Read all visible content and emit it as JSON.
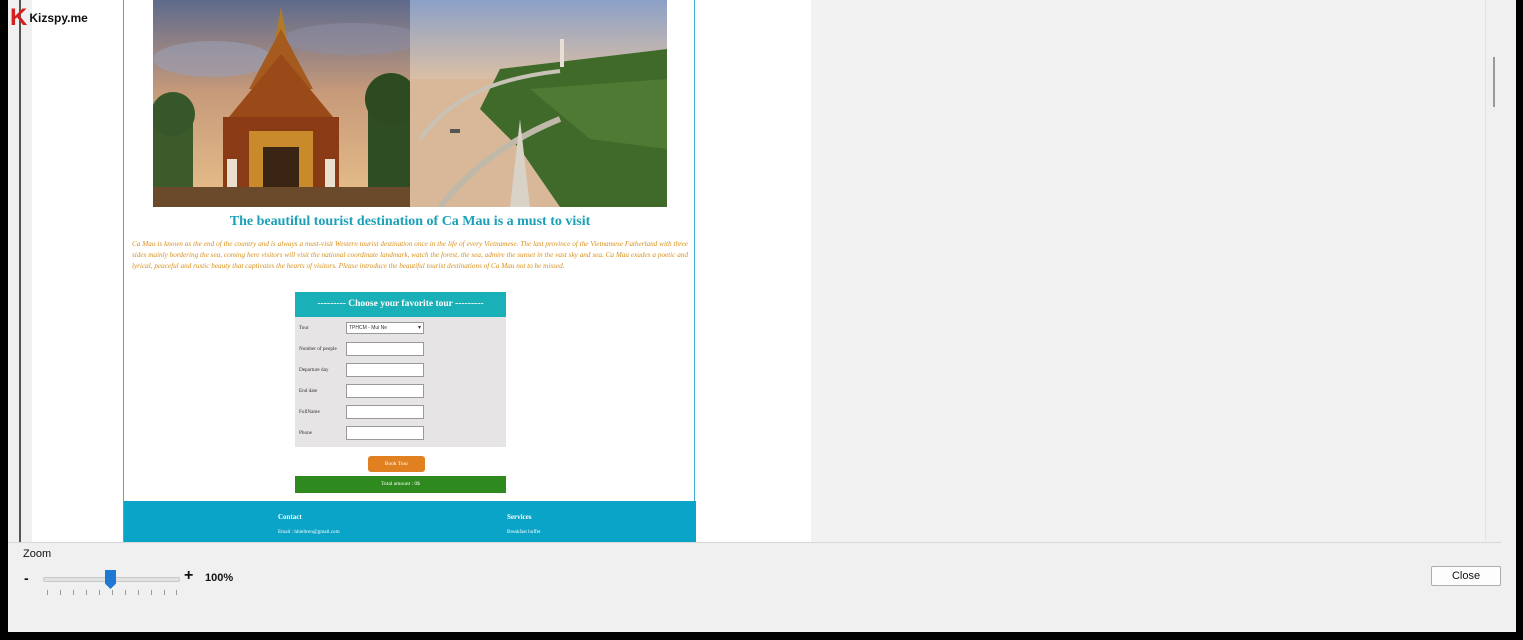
{
  "watermark": {
    "logo_letter": "K",
    "logo_text": "Kizspy.me"
  },
  "preview": {
    "headline": "The beautiful tourist destination of Ca Mau is a must to visit",
    "intro": "Ca Mau is known as the end of the country and is always a must-visit Western tourist destination once in the life of every Vietnamese. The last province of the Vietnamese Fatherland with three sides mainly bordering the sea, coming here visitors will visit the national coordinate landmark, watch the forest, the sea, admire the sunset in the vast sky and sea. Ca Mau exudes a poetic and lyrical, peaceful and rustic beauty that captivates the hearts of visitors. Please introduce the beautiful tourist destinations of Ca Mau not to be missed.",
    "form": {
      "title": "--------- Choose your favorite tour ---------",
      "tour_label": "Tour",
      "tour_value": "TPHCM - Mui Ne",
      "people_label": "Number of people",
      "departure_label": "Departure day",
      "end_label": "End date",
      "fullname_label": "FullName",
      "phone_label": "Phone"
    },
    "book_button": "Book Tour",
    "total_label": "Total amount : 0$",
    "footer": {
      "contact_heading": "Contact",
      "contact_email": "Email : hhieltren@gmail.com",
      "services_heading": "Services",
      "services_item": "Breakfast buffet"
    }
  },
  "zoom": {
    "label": "Zoom",
    "minus": "-",
    "plus": "+",
    "value_text": "100%",
    "value": 100
  },
  "actions": {
    "close_label": "Close"
  },
  "colors": {
    "accent": "#1e78d4",
    "teal": "#1ab0b8",
    "footer": "#09a4c8",
    "orange": "#e08020",
    "green": "#2e8a1e"
  }
}
